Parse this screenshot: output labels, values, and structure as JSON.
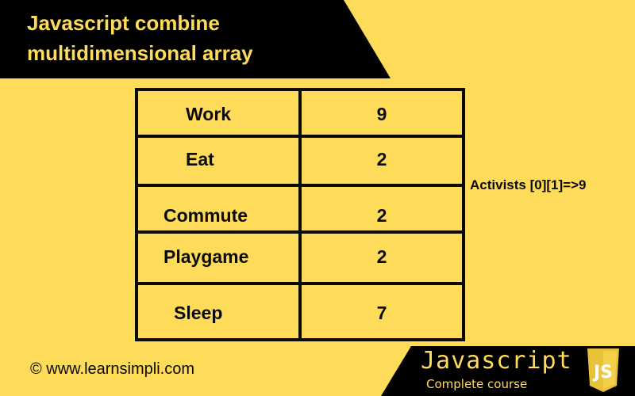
{
  "header": {
    "title_line1": "Javascript combine",
    "title_line2": "multidimensional array"
  },
  "table": {
    "rows": [
      {
        "activity": "Work",
        "hours": "9"
      },
      {
        "activity": "Eat",
        "hours": "2"
      },
      {
        "activity": "Commute",
        "hours": "2"
      },
      {
        "activity": "Playgame",
        "hours": "2"
      },
      {
        "activity": "Sleep",
        "hours": "7"
      }
    ]
  },
  "annotation": "Activists [0][1]=>9",
  "footer": {
    "copyright": "© www.learnsimpli.com"
  },
  "course_badge": {
    "title": "Javascript",
    "subtitle": "Complete course",
    "logo_icon": "js-shield-icon",
    "logo_text": "JS"
  },
  "colors": {
    "background": "#fedb58",
    "banner": "#000000",
    "accent_text": "#fedb58",
    "logo_fill": "#e8c33a"
  }
}
